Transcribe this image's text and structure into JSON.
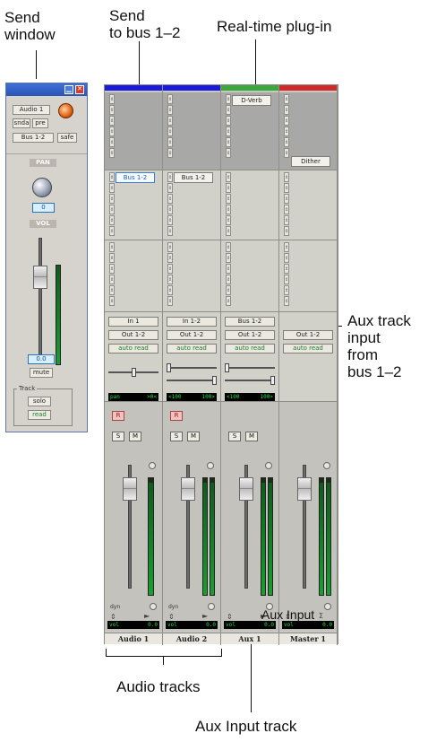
{
  "callouts": {
    "send_window": "Send\nwindow",
    "send_to_bus": "Send\nto bus 1–2",
    "realtime_plugin": "Real-time plug-in",
    "aux_input_from_bus": "Aux track\ninput\nfrom\nbus 1–2",
    "audio_tracks": "Audio tracks",
    "aux_input_track": "Aux Input track"
  },
  "send_window": {
    "track_name": "Audio 1",
    "snda": "snda",
    "pre": "pre",
    "bus": "Bus 1-2",
    "safe": "safe",
    "pan_label": "PAN",
    "pan_value": "0",
    "vol_label": "VOL",
    "vol_value": "0.0",
    "mute": "mute",
    "track_group": "Track",
    "solo": "solo",
    "read": "read"
  },
  "mixer": {
    "strips": [
      {
        "name": "Audio 1",
        "color": "#1a1adb",
        "insert": "",
        "send": "Bus 1-2",
        "input": "In 1",
        "output": "Out 1-2",
        "auto": "auto read",
        "pan_left": "pan",
        "pan_right": ">0<",
        "rec": "R",
        "solo": "S",
        "mute": "M",
        "dyn": "dyn",
        "vol_label": "vol",
        "vol_value": "0.0"
      },
      {
        "name": "Audio 2",
        "color": "#1a1adb",
        "insert": "",
        "send": "Bus 1-2",
        "input": "In 1-2",
        "output": "Out 1-2",
        "auto": "auto read",
        "pan_left": "<100",
        "pan_right": "100>",
        "rec": "R",
        "solo": "S",
        "mute": "M",
        "dyn": "dyn",
        "vol_label": "vol",
        "vol_value": "0.0"
      },
      {
        "name": "Aux 1",
        "color": "#3aa83a",
        "insert": "D-Verb",
        "send": "",
        "input": "Bus 1-2",
        "output": "Out 1-2",
        "auto": "auto read",
        "pan_left": "<100",
        "pan_right": "100>",
        "rec": "",
        "solo": "S",
        "mute": "M",
        "dyn": "",
        "vol_label": "vol",
        "vol_value": "0.0"
      },
      {
        "name": "Master 1",
        "color": "#d12828",
        "insert": "Dither",
        "send": "",
        "input": "",
        "output": "Out 1-2",
        "auto": "auto read",
        "pan_left": "",
        "pan_right": "",
        "rec": "",
        "solo": "",
        "mute": "",
        "dyn": "",
        "vol_label": "vol",
        "vol_value": "0.0"
      }
    ],
    "overlay_text": "Aux Input"
  },
  "icons": {
    "minimize": "minimize-icon",
    "close": "close-icon",
    "record_enable": "record-icon",
    "pan_knob": "pan-knob-icon"
  }
}
